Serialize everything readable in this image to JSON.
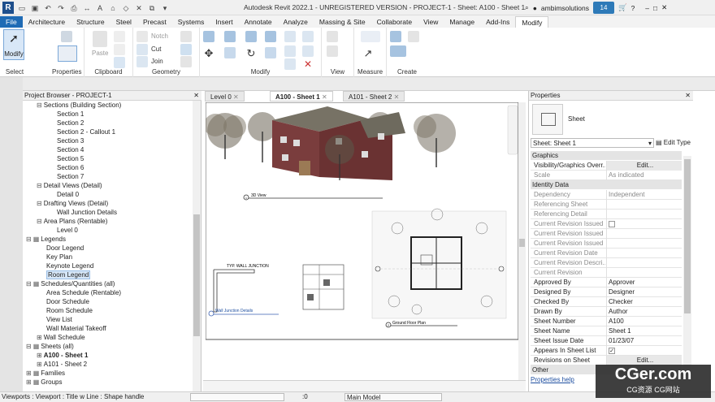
{
  "app": {
    "title": "Autodesk Revit 2022.1 - UNREGISTERED VERSION - PROJECT-1 - Sheet: A100 - Sheet 1",
    "user": "ambimsolutions",
    "clock": "14"
  },
  "qat": {
    "logo": "R"
  },
  "tabs": [
    "File",
    "Architecture",
    "Structure",
    "Steel",
    "Precast",
    "Systems",
    "Insert",
    "Annotate",
    "Analyze",
    "Massing & Site",
    "Collaborate",
    "View",
    "Manage",
    "Add-Ins",
    "Modify"
  ],
  "ribbon": {
    "modify_btn": "Modify",
    "select": "Select",
    "properties": "Properties",
    "paste": "Paste",
    "clipboard": "Clipboard",
    "notch": "Notch",
    "cut": "Cut",
    "join": "Join",
    "geometry": "Geometry",
    "modify": "Modify",
    "view": "View",
    "measure": "Measure",
    "create": "Create"
  },
  "project_browser": {
    "title": "Project Browser - PROJECT-1",
    "items": [
      {
        "label": "Sections (Building Section)",
        "level": 1,
        "toggle": "−"
      },
      {
        "label": "Section 1",
        "level": 2
      },
      {
        "label": "Section 2",
        "level": 2
      },
      {
        "label": "Section 2 - Callout 1",
        "level": 2
      },
      {
        "label": "Section 3",
        "level": 2
      },
      {
        "label": "Section 4",
        "level": 2
      },
      {
        "label": "Section 5",
        "level": 2
      },
      {
        "label": "Section 6",
        "level": 2
      },
      {
        "label": "Section 7",
        "level": 2
      },
      {
        "label": "Detail Views (Detail)",
        "level": 1,
        "toggle": "−"
      },
      {
        "label": "Detail 0",
        "level": 2
      },
      {
        "label": "Drafting Views (Detail)",
        "level": 1,
        "toggle": "−"
      },
      {
        "label": "Wall Junction Details",
        "level": 2
      },
      {
        "label": "Area Plans (Rentable)",
        "level": 1,
        "toggle": "−"
      },
      {
        "label": "Level 0",
        "level": 2
      },
      {
        "label": "Legends",
        "level": 0,
        "toggle": "−"
      },
      {
        "label": "Door Legend",
        "level": 1
      },
      {
        "label": "Key Plan",
        "level": 1
      },
      {
        "label": "Keynote Legend",
        "level": 1
      },
      {
        "label": "Room Legend",
        "level": 1,
        "selected": true
      },
      {
        "label": "Schedules/Quantities (all)",
        "level": 0,
        "toggle": "−"
      },
      {
        "label": "Area Schedule (Rentable)",
        "level": 1
      },
      {
        "label": "Door Schedule",
        "level": 1
      },
      {
        "label": "Room Schedule",
        "level": 1
      },
      {
        "label": "View List",
        "level": 1
      },
      {
        "label": "Wall Material Takeoff",
        "level": 1
      },
      {
        "label": "Wall Schedule",
        "level": 1,
        "toggle": "+"
      },
      {
        "label": "Sheets (all)",
        "level": 0,
        "toggle": "−"
      },
      {
        "label": "A100 - Sheet 1",
        "level": 1,
        "toggle": "+",
        "bold": true
      },
      {
        "label": "A101 - Sheet 2",
        "level": 1,
        "toggle": "+"
      },
      {
        "label": "Families",
        "level": 0,
        "toggle": "+"
      },
      {
        "label": "Groups",
        "level": 0,
        "toggle": "+"
      }
    ]
  },
  "view_tabs": [
    {
      "label": "Level 0"
    },
    {
      "label": "A100 - Sheet 1",
      "active": true
    },
    {
      "label": "A101 - Sheet 2"
    }
  ],
  "sheet": {
    "label_3d": "3D View",
    "label_wall": "TYP. WALL JUNCTION",
    "label_wall_details": "Wall Junction Details",
    "label_plan": "Ground Floor Plan",
    "num_3d": "1",
    "num_wall": "1",
    "num_plan": "2"
  },
  "properties": {
    "title": "Properties",
    "type_name": "Sheet",
    "selector": "Sheet: Sheet 1",
    "edit_type": "Edit Type",
    "groups": [
      {
        "name": "Graphics",
        "rows": [
          {
            "key": "Visibility/Graphics Overr...",
            "value": "Edit...",
            "button": true
          },
          {
            "key": "Scale",
            "value": "As indicated",
            "dim": true
          }
        ]
      },
      {
        "name": "Identity Data",
        "rows": [
          {
            "key": "Dependency",
            "value": "Independent",
            "dim": true
          },
          {
            "key": "Referencing Sheet",
            "value": "",
            "dim": true
          },
          {
            "key": "Referencing Detail",
            "value": "",
            "dim": true
          },
          {
            "key": "Current Revision Issued",
            "value": "",
            "checkbox": true,
            "dim": true
          },
          {
            "key": "Current Revision Issued ...",
            "value": "",
            "dim": true
          },
          {
            "key": "Current Revision Issued ...",
            "value": "",
            "dim": true
          },
          {
            "key": "Current Revision Date",
            "value": "",
            "dim": true
          },
          {
            "key": "Current Revision Descri...",
            "value": "",
            "dim": true
          },
          {
            "key": "Current Revision",
            "value": "",
            "dim": true
          },
          {
            "key": "Approved By",
            "value": "Approver"
          },
          {
            "key": "Designed By",
            "value": "Designer"
          },
          {
            "key": "Checked By",
            "value": "Checker"
          },
          {
            "key": "Drawn By",
            "value": "Author"
          },
          {
            "key": "Sheet Number",
            "value": "A100"
          },
          {
            "key": "Sheet Name",
            "value": "Sheet 1"
          },
          {
            "key": "Sheet Issue Date",
            "value": "01/23/07"
          },
          {
            "key": "Appears In Sheet List",
            "value": "✓",
            "checkbox": true
          },
          {
            "key": "Revisions on Sheet",
            "value": "Edit...",
            "button": true
          }
        ]
      },
      {
        "name": "Other",
        "rows": []
      }
    ],
    "help": "Properties help"
  },
  "statusbar": {
    "text": "Viewports : Viewport : Title w Line : Shape handle",
    "zero": ":0",
    "model": "Main Model"
  },
  "watermark": {
    "big": "CGer.com",
    "small": "CG资源 CG网站"
  },
  "colors": {
    "accent": "#1f6bb5",
    "brick": "#7a3d3d",
    "roof": "#6e6a5e"
  }
}
